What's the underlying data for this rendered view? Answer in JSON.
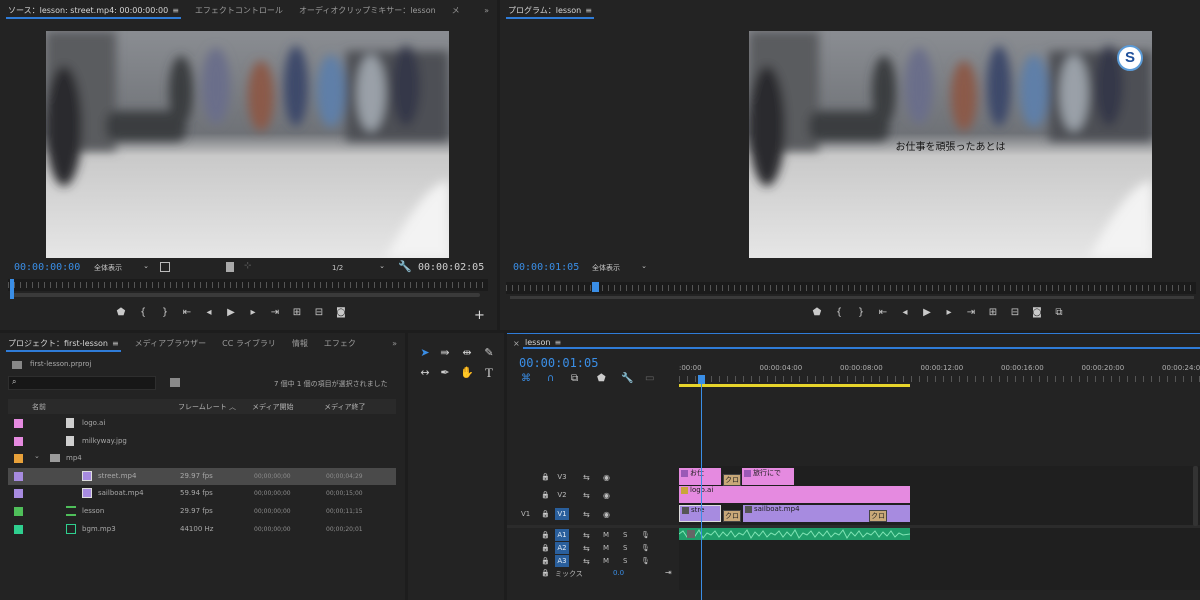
{
  "source_monitor": {
    "tabs": [
      "ソース：lesson: street.mp4: 00:00:00:00",
      "エフェクトコントロール",
      "オーディオクリップミキサー：lesson",
      "メ"
    ],
    "timecode_in": "00:00:00:00",
    "zoom": "全体表示",
    "resolution": "1/2",
    "duration": "00:00:02:05"
  },
  "program_monitor": {
    "tab": "プログラム：lesson",
    "timecode": "00:00:01:05",
    "zoom": "全体表示",
    "subtitle": "お仕事を頑張ったあとは",
    "logo_letter": "S"
  },
  "project_panel": {
    "tabs": [
      "プロジェクト：first-lesson",
      "メディアブラウザー",
      "CC ライブラリ",
      "情報",
      "エフェク"
    ],
    "file": "first-lesson.prproj",
    "search_placeholder": "",
    "selection_status": "7 個中 1 個の項目が選択されました",
    "columns": [
      "名前",
      "フレームレート",
      "メディア開始",
      "メディア終了"
    ],
    "items": [
      {
        "name": "logo.ai",
        "fps": "",
        "start": "",
        "end": "",
        "color": "#e58ae0",
        "icon": "image-file-icon",
        "indent": 1
      },
      {
        "name": "milkyway.jpg",
        "fps": "",
        "start": "",
        "end": "",
        "color": "#e58ae0",
        "icon": "image-file-icon",
        "indent": 1
      },
      {
        "name": "mp4",
        "fps": "",
        "start": "",
        "end": "",
        "color": "#e8a13a",
        "icon": "folder-icon",
        "indent": 0
      },
      {
        "name": "street.mp4",
        "fps": "29.97 fps",
        "start": "00;00;00;00",
        "end": "00;00;04;29",
        "color": "#a78be0",
        "icon": "video-file-icon",
        "indent": 2,
        "selected": true
      },
      {
        "name": "sailboat.mp4",
        "fps": "59.94 fps",
        "start": "00;00;00;00",
        "end": "00;00;15;00",
        "color": "#a78be0",
        "icon": "video-file-icon",
        "indent": 2
      },
      {
        "name": "lesson",
        "fps": "29.97 fps",
        "start": "00;00;00;00",
        "end": "00;00;11;15",
        "color": "#4fbf5a",
        "icon": "sequence-icon",
        "indent": 1
      },
      {
        "name": "bgm.mp3",
        "fps": "44100 Hz",
        "start": "00;00;00;00",
        "end": "00;00;20;01",
        "color": "#2fcf8f",
        "icon": "audio-file-icon",
        "indent": 1
      }
    ]
  },
  "timeline": {
    "tab": "lesson",
    "timecode": "00:00:01:05",
    "ruler_labels": [
      ":00:00",
      "00:00:04:00",
      "00:00:08:00",
      "00:00:12:00",
      "00:00:16:00",
      "00:00:20:00",
      "00:00:24:00"
    ],
    "video_tracks": [
      "V3",
      "V2",
      "V1"
    ],
    "audio_tracks": [
      "A1",
      "A2",
      "A3"
    ],
    "source_patch": "V1",
    "mix_label": "ミックス",
    "mix_value": "0.0",
    "clips": {
      "v3_a": "お仕",
      "v3_b": "旅行にで",
      "v2": "logo.ai",
      "v1_a": "stre",
      "v1_b": "sailboat.mp4",
      "cross": "クロ"
    },
    "ms_labels": [
      "M",
      "S"
    ]
  },
  "colors": {
    "accent": "#2f7cd8",
    "title_clip": "#e58ae0",
    "video_clip": "#a78be0",
    "audio_clip": "#1f9e6a",
    "work_area": "#e6d42b"
  }
}
